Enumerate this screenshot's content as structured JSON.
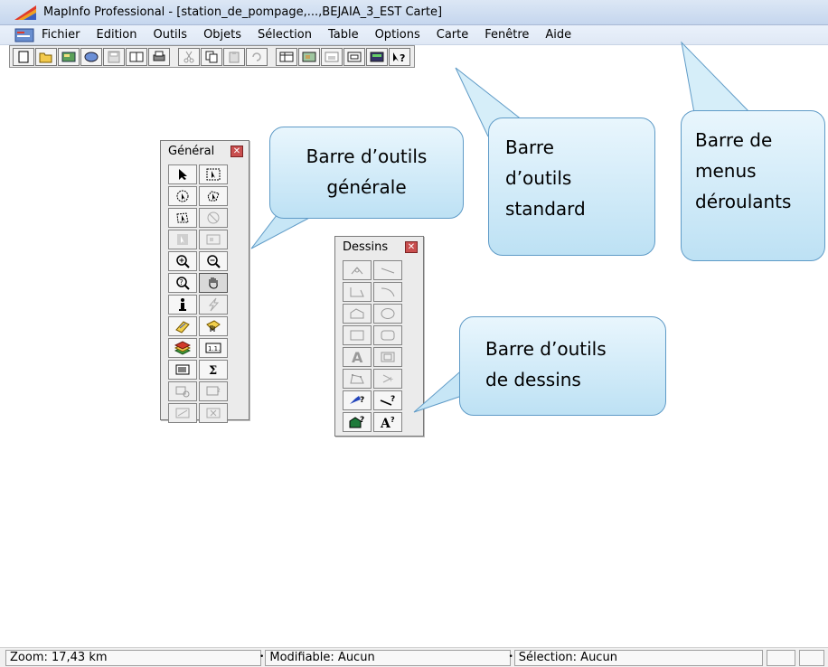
{
  "window": {
    "title": "MapInfo Professional - [station_de_pompage,...,BEJAIA_3_EST Carte]"
  },
  "menubar": {
    "items": [
      "Fichier",
      "Edition",
      "Outils",
      "Objets",
      "Sélection",
      "Table",
      "Options",
      "Carte",
      "Fenêtre",
      "Aide"
    ]
  },
  "palettes": {
    "general": {
      "title": "Général"
    },
    "dessins": {
      "title": "Dessins"
    }
  },
  "callouts": {
    "general": {
      "line1": "Barre d’outils",
      "line2": "générale"
    },
    "standard": {
      "line1": "Barre",
      "line2": "d’outils",
      "line3": "standard"
    },
    "menus": {
      "line1": "Barre de",
      "line2": "menus",
      "line3": "déroulants"
    },
    "dessins": {
      "line1": "Barre d’outils",
      "line2": "de dessins"
    }
  },
  "statusbar": {
    "zoom": "Zoom: 17,43 km",
    "modifiable": "Modifiable: Aucun",
    "selection": "Sélection: Aucun"
  },
  "colors": {
    "callout_border": "#5f9bc7",
    "callout_fill": "#bde1f4",
    "titlebar": "#c5d6ee"
  }
}
